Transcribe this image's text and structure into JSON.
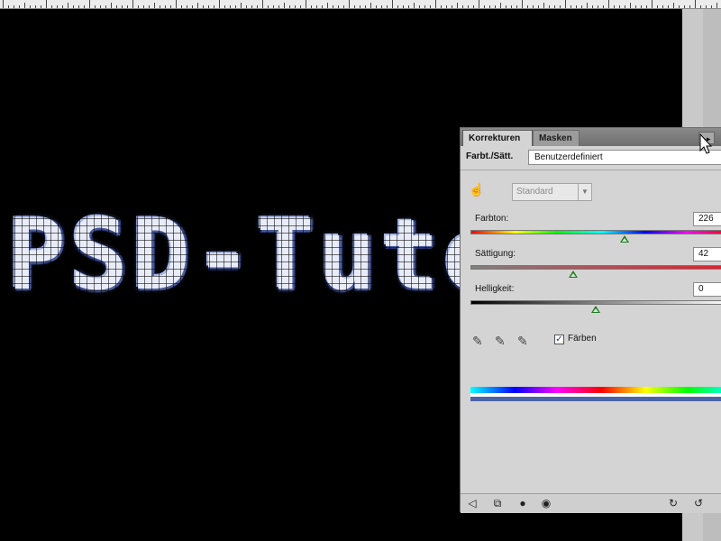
{
  "canvas": {
    "text": "PSD-Tutorials"
  },
  "panel": {
    "tabs": [
      {
        "label": "Korrekturen",
        "active": true
      },
      {
        "label": "Masken",
        "active": false
      }
    ],
    "collapse_icon": "double-arrow-right-icon",
    "adjustment_name": "Farbt./Sätt.",
    "preset": "Benutzerdefiniert",
    "range": "Standard",
    "sliders": [
      {
        "label": "Farbton:",
        "value": "226",
        "fraction": 0.615
      },
      {
        "label": "Sättigung:",
        "value": "42",
        "fraction": 0.41
      },
      {
        "label": "Helligkeit:",
        "value": "0",
        "fraction": 0.5
      }
    ],
    "colorize": {
      "label": "Färben",
      "checked": true
    },
    "colors": {
      "accent_thumb": "#1f7a1f",
      "result_strip": "#4d63a7"
    }
  }
}
